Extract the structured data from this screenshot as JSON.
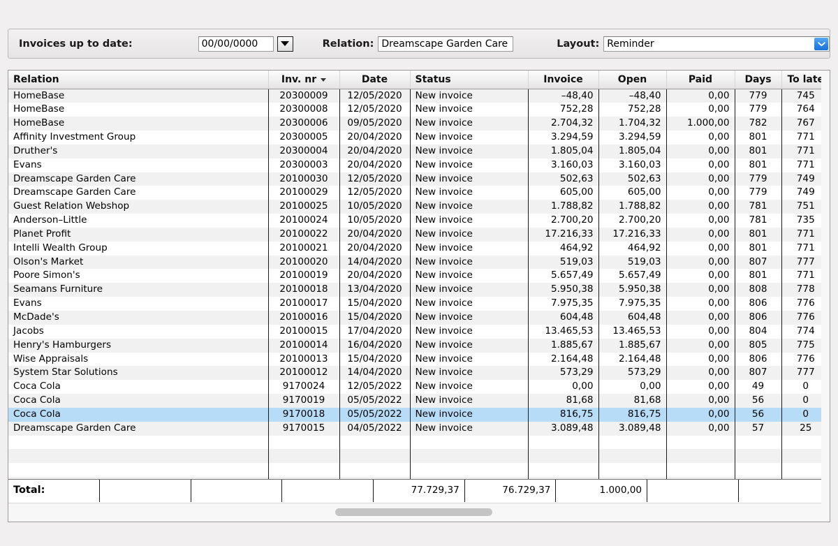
{
  "toolbar": {
    "invoices_label": "Invoices up to date:",
    "date_value": "00/00/0000",
    "date_placeholder": "00/00/0000",
    "date_dropdown_icon": "triangle-down-icon",
    "relation_label": "Relation:",
    "relation_value": "Dreamscape Garden Care",
    "relation_placeholder": "Relation",
    "layout_label": "Layout:",
    "layout_value": "Reminder",
    "layout_dropdown_icon": "chevron-down-icon",
    "accent_color": "#2d8ae8"
  },
  "table": {
    "columns": [
      "Relation",
      "Inv. nr",
      "Date",
      "Status",
      "Invoice",
      "Open",
      "Paid",
      "Days",
      "To late"
    ],
    "sort_column": "Inv. nr",
    "sort_icon": "chevron-down-icon",
    "selected_row_index": 23,
    "selection_color": "#b6dcf8",
    "rows": [
      {
        "relation": "HomeBase",
        "inv_nr": "20300009",
        "date": "12/05/2020",
        "status": "New invoice",
        "invoice": "–48,40",
        "open": "–48,40",
        "paid": "0,00",
        "days": "779",
        "to_late": "745"
      },
      {
        "relation": "HomeBase",
        "inv_nr": "20300008",
        "date": "12/05/2020",
        "status": "New invoice",
        "invoice": "752,28",
        "open": "752,28",
        "paid": "0,00",
        "days": "779",
        "to_late": "764"
      },
      {
        "relation": "HomeBase",
        "inv_nr": "20300006",
        "date": "09/05/2020",
        "status": "New invoice",
        "invoice": "2.704,32",
        "open": "1.704,32",
        "paid": "1.000,00",
        "days": "782",
        "to_late": "767"
      },
      {
        "relation": "Affinity Investment Group",
        "inv_nr": "20300005",
        "date": "20/04/2020",
        "status": "New invoice",
        "invoice": "3.294,59",
        "open": "3.294,59",
        "paid": "0,00",
        "days": "801",
        "to_late": "771"
      },
      {
        "relation": "Druther's",
        "inv_nr": "20300004",
        "date": "20/04/2020",
        "status": "New invoice",
        "invoice": "1.805,04",
        "open": "1.805,04",
        "paid": "0,00",
        "days": "801",
        "to_late": "771"
      },
      {
        "relation": "Evans",
        "inv_nr": "20300003",
        "date": "20/04/2020",
        "status": "New invoice",
        "invoice": "3.160,03",
        "open": "3.160,03",
        "paid": "0,00",
        "days": "801",
        "to_late": "771"
      },
      {
        "relation": "Dreamscape Garden Care",
        "inv_nr": "20100030",
        "date": "12/05/2020",
        "status": "New invoice",
        "invoice": "502,63",
        "open": "502,63",
        "paid": "0,00",
        "days": "779",
        "to_late": "749"
      },
      {
        "relation": "Dreamscape Garden Care",
        "inv_nr": "20100029",
        "date": "12/05/2020",
        "status": "New invoice",
        "invoice": "605,00",
        "open": "605,00",
        "paid": "0,00",
        "days": "779",
        "to_late": "749"
      },
      {
        "relation": "Guest Relation Webshop",
        "inv_nr": "20100025",
        "date": "10/05/2020",
        "status": "New invoice",
        "invoice": "1.788,82",
        "open": "1.788,82",
        "paid": "0,00",
        "days": "781",
        "to_late": "751"
      },
      {
        "relation": "Anderson–Little",
        "inv_nr": "20100024",
        "date": "10/05/2020",
        "status": "New invoice",
        "invoice": "2.700,20",
        "open": "2.700,20",
        "paid": "0,00",
        "days": "781",
        "to_late": "735"
      },
      {
        "relation": "Planet Profit",
        "inv_nr": "20100022",
        "date": "20/04/2020",
        "status": "New invoice",
        "invoice": "17.216,33",
        "open": "17.216,33",
        "paid": "0,00",
        "days": "801",
        "to_late": "771"
      },
      {
        "relation": "Intelli Wealth Group",
        "inv_nr": "20100021",
        "date": "20/04/2020",
        "status": "New invoice",
        "invoice": "464,92",
        "open": "464,92",
        "paid": "0,00",
        "days": "801",
        "to_late": "771"
      },
      {
        "relation": "Olson's Market",
        "inv_nr": "20100020",
        "date": "14/04/2020",
        "status": "New invoice",
        "invoice": "519,03",
        "open": "519,03",
        "paid": "0,00",
        "days": "807",
        "to_late": "777"
      },
      {
        "relation": "Poore Simon's",
        "inv_nr": "20100019",
        "date": "20/04/2020",
        "status": "New invoice",
        "invoice": "5.657,49",
        "open": "5.657,49",
        "paid": "0,00",
        "days": "801",
        "to_late": "771"
      },
      {
        "relation": "Seamans Furniture",
        "inv_nr": "20100018",
        "date": "13/04/2020",
        "status": "New invoice",
        "invoice": "5.950,38",
        "open": "5.950,38",
        "paid": "0,00",
        "days": "808",
        "to_late": "778"
      },
      {
        "relation": "Evans",
        "inv_nr": "20100017",
        "date": "15/04/2020",
        "status": "New invoice",
        "invoice": "7.975,35",
        "open": "7.975,35",
        "paid": "0,00",
        "days": "806",
        "to_late": "776"
      },
      {
        "relation": "McDade's",
        "inv_nr": "20100016",
        "date": "15/04/2020",
        "status": "New invoice",
        "invoice": "604,48",
        "open": "604,48",
        "paid": "0,00",
        "days": "806",
        "to_late": "776"
      },
      {
        "relation": "Jacobs",
        "inv_nr": "20100015",
        "date": "17/04/2020",
        "status": "New invoice",
        "invoice": "13.465,53",
        "open": "13.465,53",
        "paid": "0,00",
        "days": "804",
        "to_late": "774"
      },
      {
        "relation": "Henry's Hamburgers",
        "inv_nr": "20100014",
        "date": "16/04/2020",
        "status": "New invoice",
        "invoice": "1.885,67",
        "open": "1.885,67",
        "paid": "0,00",
        "days": "805",
        "to_late": "775"
      },
      {
        "relation": "Wise Appraisals",
        "inv_nr": "20100013",
        "date": "15/04/2020",
        "status": "New invoice",
        "invoice": "2.164,48",
        "open": "2.164,48",
        "paid": "0,00",
        "days": "806",
        "to_late": "776"
      },
      {
        "relation": "System Star Solutions",
        "inv_nr": "20100012",
        "date": "14/04/2020",
        "status": "New invoice",
        "invoice": "573,29",
        "open": "573,29",
        "paid": "0,00",
        "days": "807",
        "to_late": "777"
      },
      {
        "relation": "Coca Cola",
        "inv_nr": "9170024",
        "date": "12/05/2022",
        "status": "New invoice",
        "invoice": "0,00",
        "open": "0,00",
        "paid": "0,00",
        "days": "49",
        "to_late": "0"
      },
      {
        "relation": "Coca Cola",
        "inv_nr": "9170019",
        "date": "05/05/2022",
        "status": "New invoice",
        "invoice": "81,68",
        "open": "81,68",
        "paid": "0,00",
        "days": "56",
        "to_late": "0"
      },
      {
        "relation": "Coca Cola",
        "inv_nr": "9170018",
        "date": "05/05/2022",
        "status": "New invoice",
        "invoice": "816,75",
        "open": "816,75",
        "paid": "0,00",
        "days": "56",
        "to_late": "0"
      },
      {
        "relation": "Dreamscape Garden Care",
        "inv_nr": "9170015",
        "date": "04/05/2022",
        "status": "New invoice",
        "invoice": "3.089,48",
        "open": "3.089,48",
        "paid": "0,00",
        "days": "57",
        "to_late": "25"
      },
      {
        "relation": "",
        "inv_nr": "",
        "date": "",
        "status": "",
        "invoice": "",
        "open": "",
        "paid": "",
        "days": "",
        "to_late": ""
      },
      {
        "relation": "",
        "inv_nr": "",
        "date": "",
        "status": "",
        "invoice": "",
        "open": "",
        "paid": "",
        "days": "",
        "to_late": ""
      },
      {
        "relation": "",
        "inv_nr": "",
        "date": "",
        "status": "",
        "invoice": "",
        "open": "",
        "paid": "",
        "days": "",
        "to_late": ""
      },
      {
        "relation": "",
        "inv_nr": "",
        "date": "",
        "status": "",
        "invoice": "",
        "open": "",
        "paid": "",
        "days": "",
        "to_late": ""
      }
    ],
    "totals": {
      "label": "Total:",
      "invoice": "77.729,37",
      "open": "76.729,37",
      "paid": "1.000,00",
      "days": "",
      "to_late": ""
    }
  },
  "scrollbar": {
    "orientation": "horizontal"
  }
}
